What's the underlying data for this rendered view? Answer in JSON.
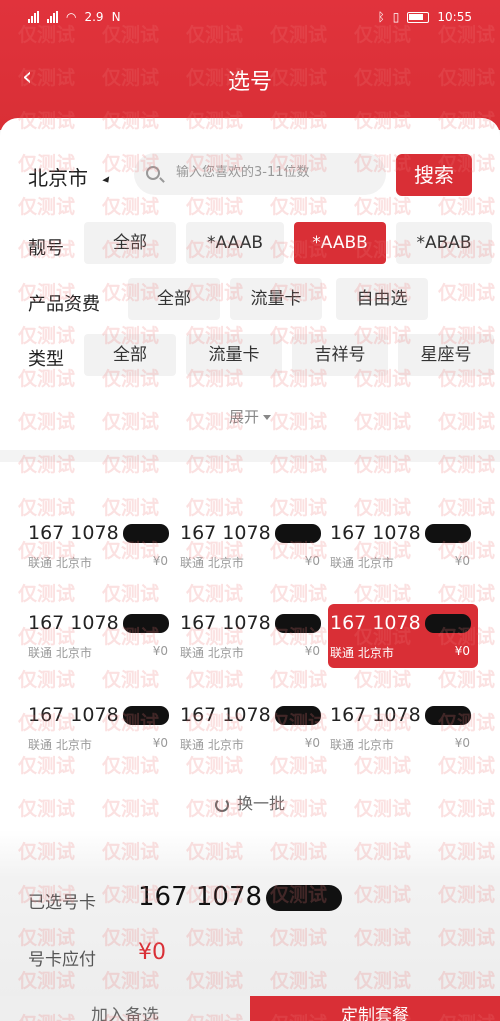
{
  "status_bar": {
    "left_text": "2.9",
    "right_text": "10:55"
  },
  "nav": {
    "back_label": "‹",
    "title": "选号"
  },
  "filters": {
    "city": "北京市",
    "search_placeholder": "输入您喜欢的3-11位数",
    "search_button": "搜索",
    "rows": [
      {
        "label": "靓号",
        "options": [
          "全部",
          "*AAAB",
          "*AABB",
          "*ABAB"
        ],
        "selected_index": 2
      },
      {
        "label": "产品资费",
        "options": [
          "全部",
          "流量卡",
          "自由选"
        ],
        "selected_index": -1
      },
      {
        "label": "类型",
        "options": [
          "全部",
          "流量卡",
          "吉祥号",
          "星座号"
        ],
        "selected_index": -1
      }
    ],
    "expand_label": "展开"
  },
  "numbers": [
    {
      "prefix": "167 1078",
      "carrier": "联通",
      "city": "北京市",
      "price": "¥0",
      "selected": false
    },
    {
      "prefix": "167 1078",
      "carrier": "联通",
      "city": "北京市",
      "price": "¥0",
      "selected": false
    },
    {
      "prefix": "167 1078",
      "carrier": "联通",
      "city": "北京市",
      "price": "¥0",
      "selected": false
    },
    {
      "prefix": "167 1078",
      "carrier": "联通",
      "city": "北京市",
      "price": "¥0",
      "selected": false
    },
    {
      "prefix": "167 1078",
      "carrier": "联通",
      "city": "北京市",
      "price": "¥0",
      "selected": false
    },
    {
      "prefix": "167 1078",
      "carrier": "联通",
      "city": "北京市",
      "price": "¥0",
      "selected": true
    },
    {
      "prefix": "167 1078",
      "carrier": "联通",
      "city": "北京市",
      "price": "¥0",
      "selected": false
    },
    {
      "prefix": "167 1078",
      "carrier": "联通",
      "city": "北京市",
      "price": "¥0",
      "selected": false
    },
    {
      "prefix": "167 1078",
      "carrier": "联通",
      "city": "北京市",
      "price": "¥0",
      "selected": false
    }
  ],
  "refresh_label": "换一批",
  "footer": {
    "selected_label": "已选号卡",
    "selected_number": "167 1078",
    "price_label": "号卡应付",
    "price_value": "¥0",
    "add_button": "加入备选",
    "submit_button": "定制套餐"
  },
  "watermark_text": "仅测试",
  "colors": {
    "brand": "#d92f36",
    "text": "#222222",
    "muted": "#999999"
  }
}
